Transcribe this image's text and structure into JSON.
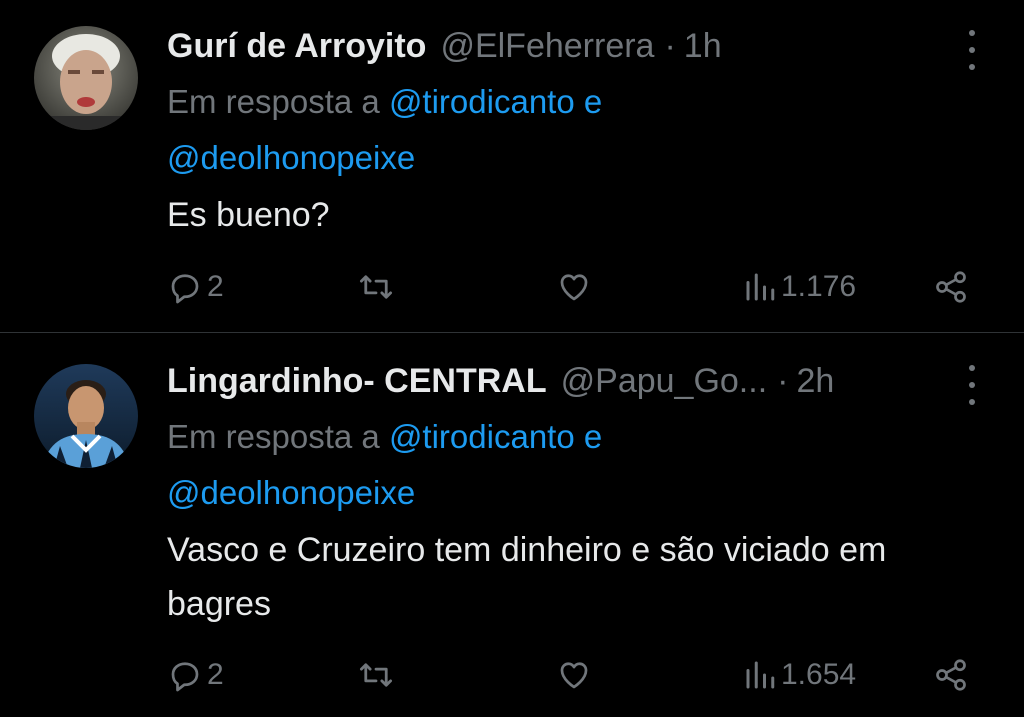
{
  "tweets": [
    {
      "name": "Gurí de Arroyito",
      "handle": "@ElFeherrera",
      "separator": "·",
      "time": "1h",
      "reply_prefix": "Em resposta a",
      "mention_1": "@tirodicanto",
      "conjunction": "e",
      "mention_2": "@deolhonopeixe",
      "text": "Es bueno?",
      "replies": "2",
      "views": "1.176"
    },
    {
      "name": "Lingardinho- CENTRAL",
      "handle": "@Papu_Go...",
      "separator": "·",
      "time": "2h",
      "reply_prefix": "Em resposta a",
      "mention_1": "@tirodicanto",
      "conjunction": "e",
      "mention_2": "@deolhonopeixe",
      "text": "Vasco e Cruzeiro tem dinheiro e são viciado em bagres",
      "replies": "2",
      "views": "1.654"
    }
  ],
  "icons": {
    "more": "more-vertical-icon",
    "reply": "reply-icon",
    "retweet": "retweet-icon",
    "like": "heart-icon",
    "views": "views-icon",
    "share": "share-icon"
  },
  "colors": {
    "background": "#000000",
    "text": "#e7e9ea",
    "muted": "#71767b",
    "link": "#1d9bf0",
    "divider": "#2f3336"
  }
}
